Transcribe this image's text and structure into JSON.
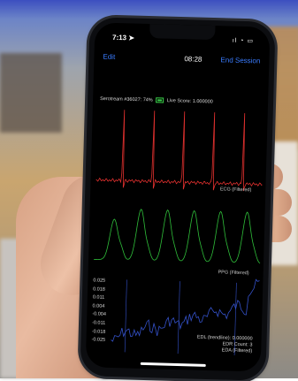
{
  "status_bar": {
    "time": "7:13",
    "location_glyph": "➤",
    "icons_text": "ıl ◔ ▭"
  },
  "nav": {
    "edit_label": "Edit",
    "timer": "08:28",
    "end_session_label": "End Session"
  },
  "device": {
    "name": "Serotream #36027: 74%",
    "battery_percent": 74,
    "live_score_label": "Live Score: 1.000000"
  },
  "ecg": {
    "label": "ECG (Filtered)",
    "color": "#e0302e"
  },
  "ppg": {
    "label": "PPG (Filtered)",
    "color": "#2fbf3a"
  },
  "eda": {
    "color": "#3451c9",
    "tick_labels": [
      "0.025",
      "0.018",
      "0.011",
      "0.004",
      "-0.004",
      "-0.011",
      "-0.018",
      "-0.025"
    ],
    "edl_label": "EDL (trendline): 0.000000",
    "edr_label": "EDR Count: 3",
    "eda_label": "EDA (Filtered)"
  },
  "colors": {
    "accent": "#3a7cff",
    "background": "#000000"
  }
}
